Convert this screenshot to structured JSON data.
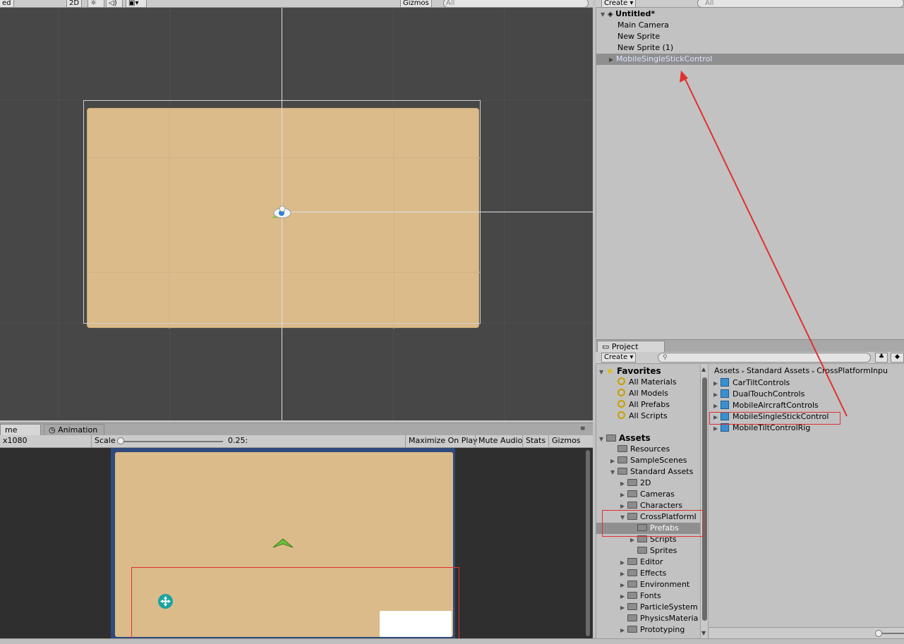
{
  "scene": {
    "toolbar": {
      "mode_fragment": "ed",
      "mode_2d": "2D",
      "gizmos": "Gizmos",
      "search_placeholder": "All"
    }
  },
  "game": {
    "tabs": {
      "game_fragment": "me",
      "animation": "Animation"
    },
    "toolbar": {
      "resolution_fragment": "x1080",
      "scale_label": "Scale",
      "scale_value": "0.25:",
      "maximize": "Maximize On Play",
      "mute": "Mute Audio",
      "stats": "Stats",
      "gizmos": "Gizmos"
    }
  },
  "hierarchy": {
    "create": "Create",
    "search_placeholder": "All",
    "scene_name": "Untitled*",
    "items": [
      "Main Camera",
      "New Sprite",
      "New Sprite (1)",
      "MobileSingleStickControl"
    ]
  },
  "project": {
    "tab": "Project",
    "create": "Create",
    "favorites": {
      "label": "Favorites",
      "items": [
        "All Materials",
        "All Models",
        "All Prefabs",
        "All Scripts"
      ]
    },
    "assets": {
      "label": "Assets",
      "resources": "Resources",
      "sample_scenes": "SampleScenes",
      "standard_assets": "Standard Assets",
      "standard_children": [
        "2D",
        "Cameras",
        "Characters"
      ],
      "cross_platform": "CrossPlatformI",
      "cross_children": [
        "Prefabs",
        "Scripts",
        "Sprites"
      ],
      "standard_more": [
        "Editor",
        "Effects",
        "Environment",
        "Fonts",
        "ParticleSystem",
        "PhysicsMateria",
        "Prototyping"
      ]
    },
    "breadcrumb": [
      "Assets",
      "Standard Assets",
      "CrossPlatformInpu"
    ],
    "prefabs": [
      "CarTiltControls",
      "DualTouchControls",
      "MobileAircraftControls",
      "MobileSingleStickControl",
      "MobileTiltControlRig"
    ]
  },
  "colors": {
    "annotation": "#e03030",
    "selection": "#8f8f8f",
    "sprite": "#dbbb8a"
  }
}
